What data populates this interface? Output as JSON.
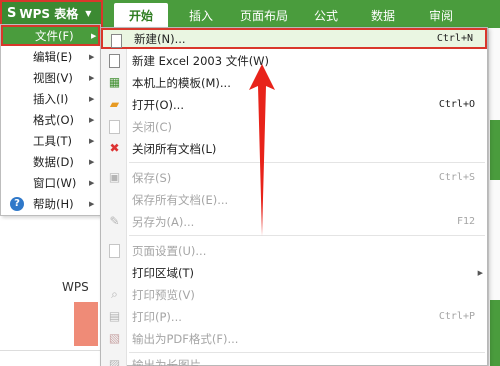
{
  "app": {
    "title": "WPS 表格"
  },
  "ribbon": {
    "tabs": [
      {
        "label": "开始"
      },
      {
        "label": "插入"
      },
      {
        "label": "页面布局"
      },
      {
        "label": "公式"
      },
      {
        "label": "数据"
      },
      {
        "label": "审阅"
      }
    ]
  },
  "main_menu": {
    "items": [
      {
        "label": "文件(F)",
        "highlighted": true
      },
      {
        "label": "编辑(E)"
      },
      {
        "label": "视图(V)"
      },
      {
        "label": "插入(I)"
      },
      {
        "label": "格式(O)"
      },
      {
        "label": "工具(T)"
      },
      {
        "label": "数据(D)"
      },
      {
        "label": "窗口(W)"
      },
      {
        "label": "帮助(H)"
      }
    ]
  },
  "file_menu": {
    "items": [
      {
        "label": "新建(N)...",
        "shortcut": "Ctrl+N",
        "icon": "new-doc-icon",
        "highlighted": true
      },
      {
        "label": "新建 Excel 2003 文件(W)",
        "shortcut": "",
        "icon": "new-excel-doc-icon"
      },
      {
        "label": "本机上的模板(M)...",
        "shortcut": "",
        "icon": "template-icon"
      },
      {
        "label": "打开(O)...",
        "shortcut": "Ctrl+O",
        "icon": "open-folder-icon"
      },
      {
        "label": "关闭(C)",
        "shortcut": "",
        "icon": "close-doc-icon",
        "disabled": true
      },
      {
        "label": "关闭所有文档(L)",
        "shortcut": "",
        "icon": "close-all-docs-icon"
      },
      {
        "label": "保存(S)",
        "shortcut": "Ctrl+S",
        "icon": "save-icon",
        "disabled": true
      },
      {
        "label": "保存所有文档(E)...",
        "shortcut": "",
        "icon": "",
        "disabled": true
      },
      {
        "label": "另存为(A)...",
        "shortcut": "F12",
        "icon": "save-as-icon",
        "disabled": true
      },
      {
        "label": "页面设置(U)...",
        "shortcut": "",
        "icon": "page-setup-icon",
        "disabled": true
      },
      {
        "label": "打印区域(T)",
        "shortcut": "",
        "icon": "",
        "submenu": true
      },
      {
        "label": "打印预览(V)",
        "shortcut": "",
        "icon": "print-preview-icon",
        "disabled": true
      },
      {
        "label": "打印(P)...",
        "shortcut": "Ctrl+P",
        "icon": "print-icon",
        "disabled": true
      },
      {
        "label": "输出为PDF格式(F)...",
        "shortcut": "",
        "icon": "pdf-export-icon",
        "disabled": true
      },
      {
        "label": "输出为长图片",
        "shortcut": "",
        "icon": "image-export-icon",
        "disabled": true
      }
    ]
  },
  "background": {
    "label": "WPS"
  },
  "colors": {
    "brand_green": "#4a9c3d",
    "highlight_red": "#d9372b",
    "arrow_red": "#e8231a"
  }
}
